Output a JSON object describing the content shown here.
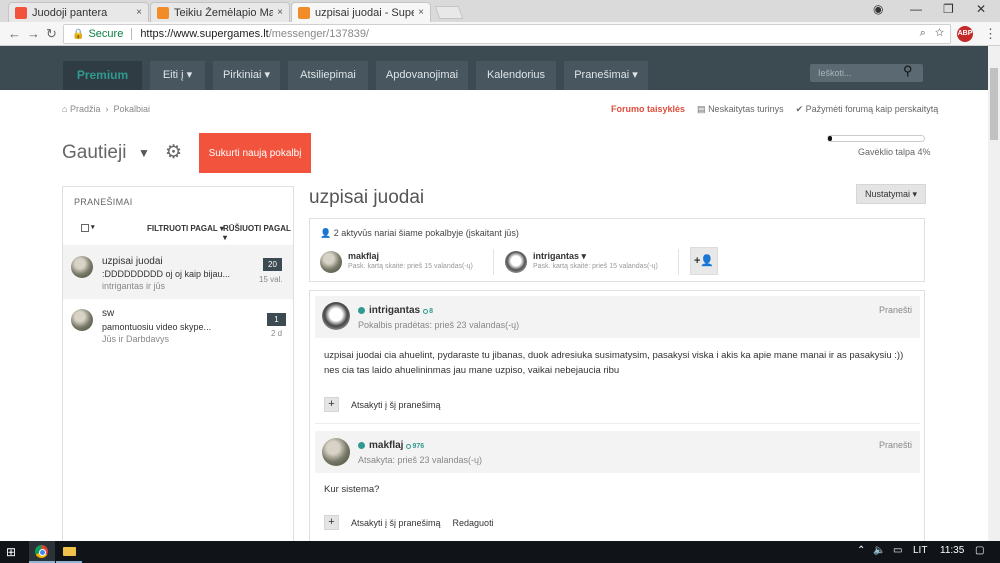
{
  "browser": {
    "tabs": [
      {
        "title": "Juodoji pantera",
        "favicon_color": "#f1533c"
      },
      {
        "title": "Teikiu Žemėlapio Maketu",
        "favicon_color": "#f28c28"
      },
      {
        "title": "uzpisai juodai - SuperGam",
        "favicon_color": "#f28c28"
      }
    ],
    "tab_close": "×",
    "secure_label": "Secure",
    "url_host": "https://www.supergames.lt",
    "url_path": "/messenger/137839/",
    "extension_badge": "ABP"
  },
  "site_nav": {
    "items": [
      "Premium",
      "Eiti į ▾",
      "Pirkiniai ▾",
      "Atsiliepimai",
      "Apdovanojimai",
      "Kalendorius",
      "Pranešimai ▾"
    ],
    "search_placeholder": "Ieškoti..."
  },
  "breadcrumb": {
    "home": "Pradžia",
    "separator": "›",
    "current": "Pokalbiai"
  },
  "top_links": {
    "rules": "Forumo taisyklės",
    "unread": "Neskaitytas turinys",
    "mark_read": "Pažymėti forumą kaip perskaitytą"
  },
  "folder": {
    "title": "Gautieji",
    "compose": "Sukurti naują pokalbį"
  },
  "quota": {
    "label": "Gavėklio talpa 4%",
    "percent": 4
  },
  "sidebar": {
    "heading": "PRANEŠIMAI",
    "filter": "FILTRUOTI PAGAL ▾",
    "sort": "RŪŠIUOTI PAGAL ▾",
    "conversations": [
      {
        "title": "uzpisai juodai",
        "preview": ":DDDDDDDDD oj oj kaip bijau...",
        "people": "intrigantas ir jūs",
        "count": "20",
        "time": "15 val."
      },
      {
        "title": "sw",
        "preview": "pamontuosiu video skype...",
        "people": "Jūs ir Darbdavys",
        "count": "1",
        "time": "2 d"
      }
    ]
  },
  "conversation": {
    "title": "uzpisai juodai",
    "settings": "Nustatymai ▾",
    "members_count": "2 aktyvūs nariai šiame pokalbyje (įskaitant jūs)",
    "members": [
      {
        "name": "makflaj",
        "seen": "Pask. kartą skaitė: prieš 15 valandas(-ų)"
      },
      {
        "name": "intrigantas ▾",
        "seen": "Pask. kartą skaitė: prieš 15 valandas(-ų)"
      }
    ],
    "add_member": "+👤"
  },
  "posts": [
    {
      "author": "intrigantas",
      "rep": "8",
      "meta": "Pokalbis pradėtas: prieš 23 valandas(-ų)",
      "report": "Pranešti",
      "body": "uzpisai juodai cia ahuelint, pydaraste tu jibanas, duok adresiuka susimatysim, pasakysi viska i akis ka apie mane manai ir as pasakysiu :)) nes cia tas laido ahuelininmas jau mane uzpiso, vaikai nebejaucia ribu",
      "reply": "Atsakyti į šį pranešimą"
    },
    {
      "author": "makflaj",
      "rep": "976",
      "meta": "Atsakyta: prieš 23 valandas(-ų)",
      "report": "Pranešti",
      "body": "Kur sistema?",
      "reply": "Atsakyti į šį pranešimą",
      "edit": "Redaguoti"
    }
  ],
  "taskbar": {
    "language": "LIT",
    "time": "11:35"
  },
  "colors": {
    "nav_bg": "#3c4a52",
    "accent": "#f1533c",
    "online": "#2f9a8f"
  }
}
